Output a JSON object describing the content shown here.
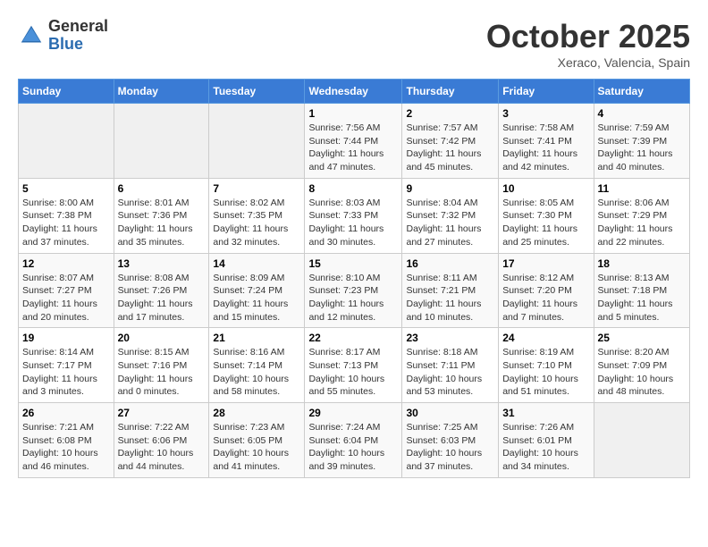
{
  "header": {
    "logo_general": "General",
    "logo_blue": "Blue",
    "month_title": "October 2025",
    "location": "Xeraco, Valencia, Spain"
  },
  "weekdays": [
    "Sunday",
    "Monday",
    "Tuesday",
    "Wednesday",
    "Thursday",
    "Friday",
    "Saturday"
  ],
  "weeks": [
    [
      {
        "day": "",
        "info": ""
      },
      {
        "day": "",
        "info": ""
      },
      {
        "day": "",
        "info": ""
      },
      {
        "day": "1",
        "info": "Sunrise: 7:56 AM\nSunset: 7:44 PM\nDaylight: 11 hours\nand 47 minutes."
      },
      {
        "day": "2",
        "info": "Sunrise: 7:57 AM\nSunset: 7:42 PM\nDaylight: 11 hours\nand 45 minutes."
      },
      {
        "day": "3",
        "info": "Sunrise: 7:58 AM\nSunset: 7:41 PM\nDaylight: 11 hours\nand 42 minutes."
      },
      {
        "day": "4",
        "info": "Sunrise: 7:59 AM\nSunset: 7:39 PM\nDaylight: 11 hours\nand 40 minutes."
      }
    ],
    [
      {
        "day": "5",
        "info": "Sunrise: 8:00 AM\nSunset: 7:38 PM\nDaylight: 11 hours\nand 37 minutes."
      },
      {
        "day": "6",
        "info": "Sunrise: 8:01 AM\nSunset: 7:36 PM\nDaylight: 11 hours\nand 35 minutes."
      },
      {
        "day": "7",
        "info": "Sunrise: 8:02 AM\nSunset: 7:35 PM\nDaylight: 11 hours\nand 32 minutes."
      },
      {
        "day": "8",
        "info": "Sunrise: 8:03 AM\nSunset: 7:33 PM\nDaylight: 11 hours\nand 30 minutes."
      },
      {
        "day": "9",
        "info": "Sunrise: 8:04 AM\nSunset: 7:32 PM\nDaylight: 11 hours\nand 27 minutes."
      },
      {
        "day": "10",
        "info": "Sunrise: 8:05 AM\nSunset: 7:30 PM\nDaylight: 11 hours\nand 25 minutes."
      },
      {
        "day": "11",
        "info": "Sunrise: 8:06 AM\nSunset: 7:29 PM\nDaylight: 11 hours\nand 22 minutes."
      }
    ],
    [
      {
        "day": "12",
        "info": "Sunrise: 8:07 AM\nSunset: 7:27 PM\nDaylight: 11 hours\nand 20 minutes."
      },
      {
        "day": "13",
        "info": "Sunrise: 8:08 AM\nSunset: 7:26 PM\nDaylight: 11 hours\nand 17 minutes."
      },
      {
        "day": "14",
        "info": "Sunrise: 8:09 AM\nSunset: 7:24 PM\nDaylight: 11 hours\nand 15 minutes."
      },
      {
        "day": "15",
        "info": "Sunrise: 8:10 AM\nSunset: 7:23 PM\nDaylight: 11 hours\nand 12 minutes."
      },
      {
        "day": "16",
        "info": "Sunrise: 8:11 AM\nSunset: 7:21 PM\nDaylight: 11 hours\nand 10 minutes."
      },
      {
        "day": "17",
        "info": "Sunrise: 8:12 AM\nSunset: 7:20 PM\nDaylight: 11 hours\nand 7 minutes."
      },
      {
        "day": "18",
        "info": "Sunrise: 8:13 AM\nSunset: 7:18 PM\nDaylight: 11 hours\nand 5 minutes."
      }
    ],
    [
      {
        "day": "19",
        "info": "Sunrise: 8:14 AM\nSunset: 7:17 PM\nDaylight: 11 hours\nand 3 minutes."
      },
      {
        "day": "20",
        "info": "Sunrise: 8:15 AM\nSunset: 7:16 PM\nDaylight: 11 hours\nand 0 minutes."
      },
      {
        "day": "21",
        "info": "Sunrise: 8:16 AM\nSunset: 7:14 PM\nDaylight: 10 hours\nand 58 minutes."
      },
      {
        "day": "22",
        "info": "Sunrise: 8:17 AM\nSunset: 7:13 PM\nDaylight: 10 hours\nand 55 minutes."
      },
      {
        "day": "23",
        "info": "Sunrise: 8:18 AM\nSunset: 7:11 PM\nDaylight: 10 hours\nand 53 minutes."
      },
      {
        "day": "24",
        "info": "Sunrise: 8:19 AM\nSunset: 7:10 PM\nDaylight: 10 hours\nand 51 minutes."
      },
      {
        "day": "25",
        "info": "Sunrise: 8:20 AM\nSunset: 7:09 PM\nDaylight: 10 hours\nand 48 minutes."
      }
    ],
    [
      {
        "day": "26",
        "info": "Sunrise: 7:21 AM\nSunset: 6:08 PM\nDaylight: 10 hours\nand 46 minutes."
      },
      {
        "day": "27",
        "info": "Sunrise: 7:22 AM\nSunset: 6:06 PM\nDaylight: 10 hours\nand 44 minutes."
      },
      {
        "day": "28",
        "info": "Sunrise: 7:23 AM\nSunset: 6:05 PM\nDaylight: 10 hours\nand 41 minutes."
      },
      {
        "day": "29",
        "info": "Sunrise: 7:24 AM\nSunset: 6:04 PM\nDaylight: 10 hours\nand 39 minutes."
      },
      {
        "day": "30",
        "info": "Sunrise: 7:25 AM\nSunset: 6:03 PM\nDaylight: 10 hours\nand 37 minutes."
      },
      {
        "day": "31",
        "info": "Sunrise: 7:26 AM\nSunset: 6:01 PM\nDaylight: 10 hours\nand 34 minutes."
      },
      {
        "day": "",
        "info": ""
      }
    ]
  ]
}
